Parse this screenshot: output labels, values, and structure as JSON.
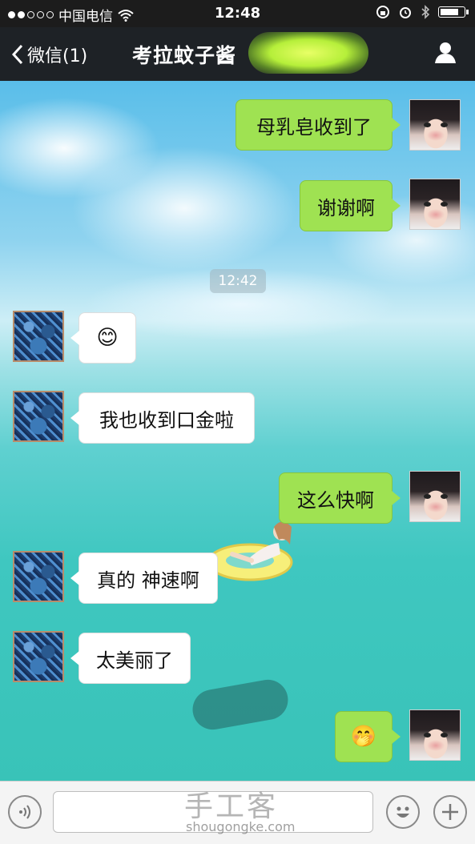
{
  "status_bar": {
    "carrier": "中国电信",
    "time": "12:48"
  },
  "nav": {
    "back_label": "微信(1)",
    "title": "考拉蚊子酱"
  },
  "timestamp": "12:42",
  "messages": [
    {
      "side": "me",
      "text": "母乳皂收到了"
    },
    {
      "side": "me",
      "text": "谢谢啊"
    },
    {
      "side": "other",
      "text": "😊"
    },
    {
      "side": "other",
      "text": "我也收到口金啦"
    },
    {
      "side": "me",
      "text": "这么快啊"
    },
    {
      "side": "other",
      "text": "真的 神速啊"
    },
    {
      "side": "other",
      "text": "太美丽了"
    },
    {
      "side": "me",
      "text": "🤭"
    }
  ],
  "input_bar": {
    "placeholder": ""
  },
  "watermark": {
    "cn": "手工客",
    "en": "shougongke.com"
  }
}
